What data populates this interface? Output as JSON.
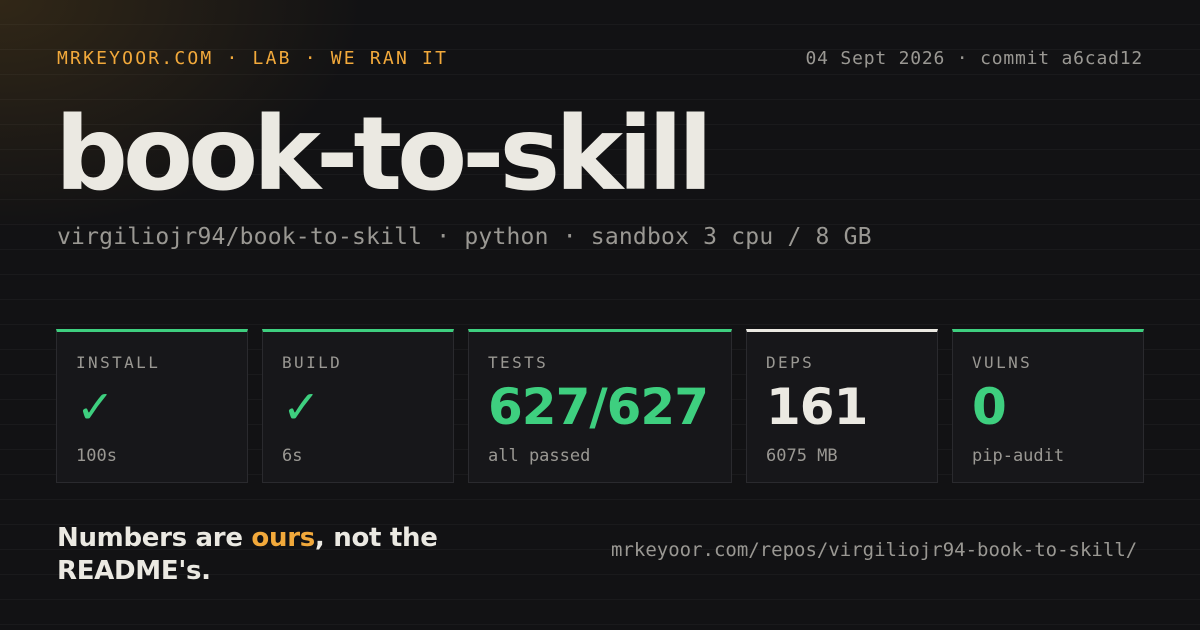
{
  "header": {
    "kicker": "MRKEYOOR.COM · LAB · WE RAN IT",
    "meta": "04 Sept 2026 · commit a6cad12"
  },
  "title": "book-to-skill",
  "subtitle": "virgiliojr94/book-to-skill · python · sandbox 3 cpu / 8 GB",
  "cards": [
    {
      "label": "INSTALL",
      "icon": "check-icon",
      "glyph": "✓",
      "sub": "100s",
      "accent": "#3ecf7f"
    },
    {
      "label": "BUILD",
      "icon": "check-icon",
      "glyph": "✓",
      "sub": "6s",
      "accent": "#3ecf7f"
    },
    {
      "label": "TESTS",
      "value": "627/627",
      "sub": "all passed",
      "accent": "#3ecf7f"
    },
    {
      "label": "DEPS",
      "value": "161",
      "sub": "6075 MB",
      "accent": "#ebe9e2"
    },
    {
      "label": "VULNS",
      "value": "0",
      "sub": "pip-audit",
      "accent": "#3ecf7f"
    }
  ],
  "tagline": {
    "before": "Numbers are ",
    "highlight": "ours",
    "after": ", not the README's."
  },
  "url": "mrkeyoor.com/repos/virgiliojr94-book-to-skill/",
  "colors": {
    "background": "#121214",
    "accent_orange": "#f2a93b",
    "success_green": "#3ecf7f",
    "text_primary": "#ebe9e2",
    "text_muted": "#9a9893"
  }
}
